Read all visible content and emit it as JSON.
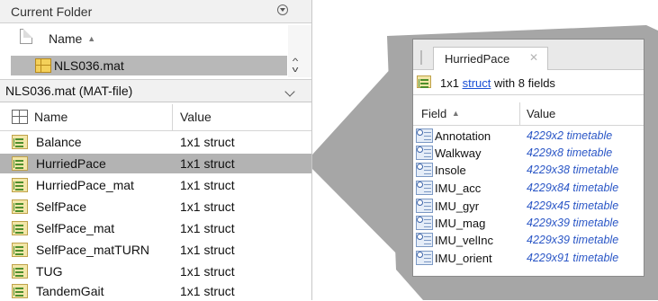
{
  "current_folder": {
    "title": "Current Folder",
    "name_column": "Name",
    "sort_indicator": "▲",
    "selected_file": "NLS036.mat"
  },
  "details": {
    "title": "NLS036.mat  (MAT-file)",
    "columns": {
      "name": "Name",
      "value": "Value"
    },
    "variables": [
      {
        "name": "Balance",
        "value": "1x1 struct",
        "selected": false
      },
      {
        "name": "HurriedPace",
        "value": "1x1 struct",
        "selected": true
      },
      {
        "name": "HurriedPace_mat",
        "value": "1x1 struct",
        "selected": false
      },
      {
        "name": "SelfPace",
        "value": "1x1 struct",
        "selected": false
      },
      {
        "name": "SelfPace_mat",
        "value": "1x1 struct",
        "selected": false
      },
      {
        "name": "SelfPace_matTURN",
        "value": "1x1 struct",
        "selected": false
      },
      {
        "name": "TUG",
        "value": "1x1 struct",
        "selected": false
      },
      {
        "name": "TandemGait",
        "value": "1x1 struct",
        "selected": false
      }
    ]
  },
  "variable_editor": {
    "tab_label": "HurriedPace",
    "tab_close": "✕",
    "summary_prefix": "1x1",
    "summary_link": "struct",
    "summary_suffix": "with 8 fields",
    "columns": {
      "field": "Field",
      "value": "Value"
    },
    "sort_indicator": "▲",
    "fields": [
      {
        "name": "Annotation",
        "value": "4229x2 timetable"
      },
      {
        "name": "Walkway",
        "value": "4229x8 timetable"
      },
      {
        "name": "Insole",
        "value": "4229x38 timetable"
      },
      {
        "name": "IMU_acc",
        "value": "4229x84 timetable"
      },
      {
        "name": "IMU_gyr",
        "value": "4229x45 timetable"
      },
      {
        "name": "IMU_mag",
        "value": "4229x39 timetable"
      },
      {
        "name": "IMU_velInc",
        "value": "4229x39 timetable"
      },
      {
        "name": "IMU_orient",
        "value": "4229x91 timetable"
      }
    ]
  },
  "colors": {
    "selection": "#b3b3b3",
    "link": "#1a4fd6",
    "timetable_value": "#2a56c6",
    "zoom_beam": "#a6a6a6"
  }
}
